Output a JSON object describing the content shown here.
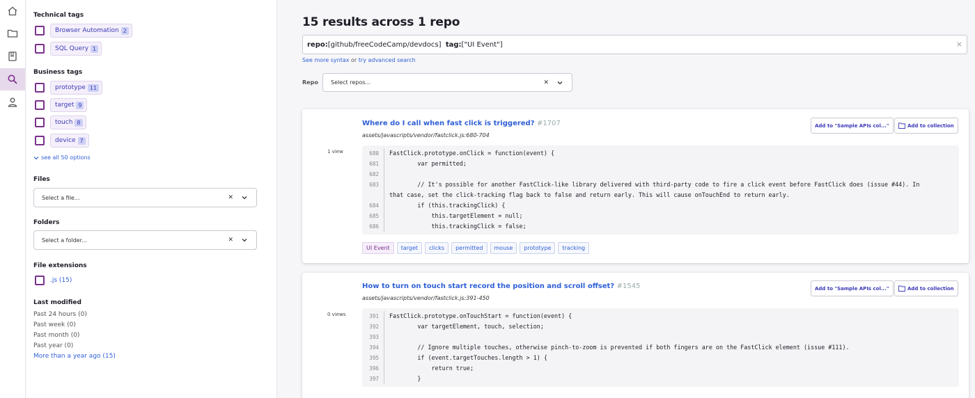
{
  "rail": {
    "items": [
      "home-icon",
      "folder-icon",
      "book-icon",
      "search-icon",
      "user-icon"
    ],
    "active": "search-icon",
    "accent": "#7a2f8b"
  },
  "filters": {
    "technical_tags": {
      "title": "Technical tags",
      "items": [
        {
          "label": "Browser Automation",
          "count": "2"
        },
        {
          "label": "SQL Query",
          "count": "1"
        }
      ]
    },
    "business_tags": {
      "title": "Business tags",
      "items": [
        {
          "label": "prototype",
          "count": "11"
        },
        {
          "label": "target",
          "count": "9"
        },
        {
          "label": "touch",
          "count": "8"
        },
        {
          "label": "device",
          "count": "7"
        }
      ],
      "see_all": "see all 50 options"
    },
    "files": {
      "title": "Files",
      "placeholder": "Select a file..."
    },
    "folders": {
      "title": "Folders",
      "placeholder": "Select a folder..."
    },
    "file_extensions": {
      "title": "File extensions",
      "items": [
        {
          "label": ".js (15)"
        }
      ]
    },
    "last_modified": {
      "title": "Last modified",
      "items": [
        "Past 24 hours (0)",
        "Past week (0)",
        "Past month (0)",
        "Past year (0)",
        "More than a year ago (15)"
      ]
    }
  },
  "main": {
    "title": "15 results across 1 repo",
    "query": {
      "repo_key": "repo:",
      "repo_value": "[github/freeCodeCamp/devdocs]",
      "tag_key": "tag:",
      "tag_value": "[\"UI Event\"]",
      "clear": "×"
    },
    "syntax": {
      "see_more": "See more syntax",
      "or": "or",
      "advanced": "try advanced search"
    },
    "repo_filter": {
      "label": "Repo",
      "placeholder": "Select repos..."
    },
    "results": [
      {
        "title": "Where do I call when fast click is triggered?",
        "number": "#1707",
        "path": "assets/javascripts/vendor/fastclick.js:680-704",
        "views": "1 view",
        "add_to_named": "Add to \"Sample APIs col...\"",
        "add_to_collection": "Add to collection",
        "lines": [
          {
            "n": "680",
            "t": "FastClick.prototype.onClick = function(event) {"
          },
          {
            "n": "681",
            "t": "        var permitted;"
          },
          {
            "n": "682",
            "t": ""
          },
          {
            "n": "683",
            "t": "        // It's possible for another FastClick-like library delivered with third-party code to fire a click event before FastClick does (issue #44). In that case, set the click-tracking flag back to false and return early. This will cause onTouchEnd to return early."
          },
          {
            "n": "684",
            "t": "        if (this.trackingClick) {"
          },
          {
            "n": "685",
            "t": "            this.targetElement = null;"
          },
          {
            "n": "686",
            "t": "            this.trackingClick = false;"
          }
        ],
        "tags": [
          "UI Event",
          "target",
          "clicks",
          "permitted",
          "mouse",
          "prototype",
          "tracking"
        ]
      },
      {
        "title": "How to turn on touch start record the position and scroll offset?",
        "number": "#1545",
        "path": "assets/javascripts/vendor/fastclick.js:391-450",
        "views": "0 views",
        "add_to_named": "Add to \"Sample APIs col...\"",
        "add_to_collection": "Add to collection",
        "lines": [
          {
            "n": "391",
            "t": "FastClick.prototype.onTouchStart = function(event) {"
          },
          {
            "n": "392",
            "t": "        var targetElement, touch, selection;"
          },
          {
            "n": "393",
            "t": ""
          },
          {
            "n": "394",
            "t": "        // Ignore multiple touches, otherwise pinch-to-zoom is prevented if both fingers are on the FastClick element (issue #111)."
          },
          {
            "n": "395",
            "t": "        if (event.targetTouches.length > 1) {"
          },
          {
            "n": "396",
            "t": "            return true;"
          },
          {
            "n": "397",
            "t": "        }"
          }
        ]
      }
    ]
  }
}
